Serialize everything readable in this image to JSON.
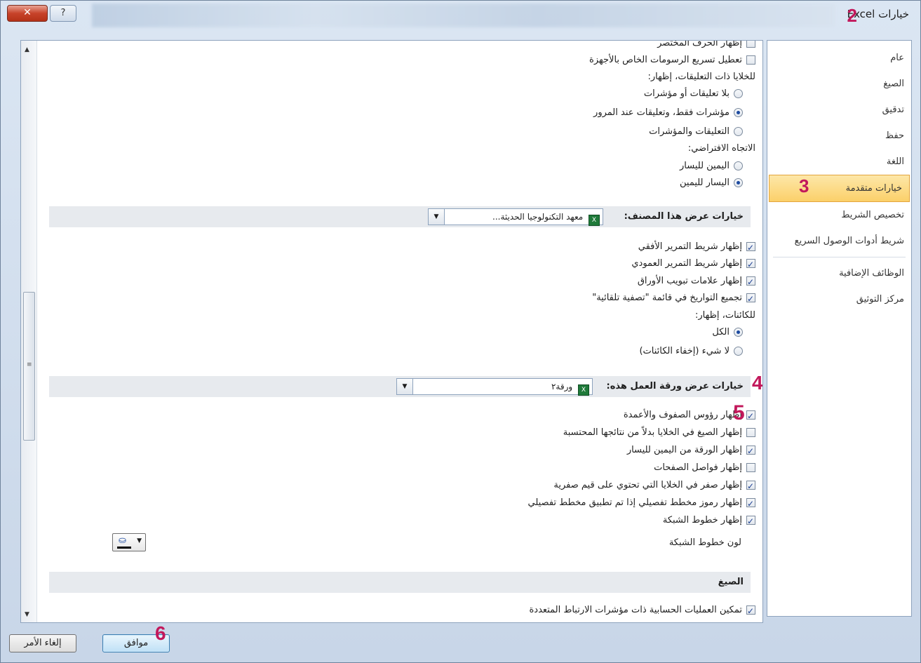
{
  "window": {
    "title": "خيارات Excel",
    "close_label": "✕",
    "help_label": "?"
  },
  "steps": {
    "s2": "2",
    "s3": "3",
    "s4": "4",
    "s5": "5",
    "s6": "6"
  },
  "sidebar": {
    "items": [
      "عام",
      "الصيغ",
      "تدقيق",
      "حفظ",
      "اللغة",
      "خيارات متقدمة",
      "تخصيص الشريط",
      "شريط أدوات الوصول السريع",
      "الوظائف الإضافية",
      "مركز التوثيق"
    ],
    "active_index": 5
  },
  "top_options": {
    "partial_top": "إظهار الحرف المختصر",
    "disable_hw_accel": "تعطيل تسريع الرسومات الخاص بالأجهزة",
    "comments_label": "للخلايا ذات التعليقات، إظهار:",
    "no_comments": "بلا تعليقات أو مؤشرات",
    "indicators_only": "مؤشرات فقط، وتعليقات عند المرور",
    "comments_indicators": "التعليقات والمؤشرات",
    "direction_label": "الاتجاه الافتراضي:",
    "rtl": "اليمين لليسار",
    "ltr": "اليسار لليمين"
  },
  "workbook_section": {
    "title": "خيارات عرض هذا المصنف:",
    "combo_value": "معهد التكنولوجيا الحديثة...",
    "hscroll": "إظهار شريط التمرير الأفقي",
    "vscroll": "إظهار شريط التمرير العمودي",
    "sheet_tabs": "إظهار علامات تبويب الأوراق",
    "group_dates": "تجميع التواريخ في قائمة \"تصفية تلقائية\"",
    "objects_label": "للكائنات، إظهار:",
    "all": "الكل",
    "nothing": "لا شيء (إخفاء الكائنات)"
  },
  "sheet_section": {
    "title": "خيارات عرض ورقة العمل هذه:",
    "combo_value": "ورقة٢",
    "headers": "إظهار رؤوس الصفوف والأعمدة",
    "formulas": "إظهار الصيغ في الخلايا بدلاً من نتائجها المحتسبة",
    "rtl_sheet": "إظهار الورقة من اليمين لليسار",
    "page_breaks": "إظهار فواصل الصفحات",
    "zeros": "إظهار صفر في الخلايا التي تحتوي على قيم صفرية",
    "outline": "إظهار رموز مخطط تفصيلي إذا تم تطبيق مخطط تفصيلي",
    "gridlines": "إظهار خطوط الشبكة",
    "grid_color": "لون خطوط الشبكة"
  },
  "formulas_section": {
    "title": "الصيغ",
    "multithread": "تمكين العمليات الحسابية ذات مؤشرات الارتباط المتعددة"
  },
  "footer": {
    "ok": "موافق",
    "cancel": "إلغاء الأمر"
  }
}
